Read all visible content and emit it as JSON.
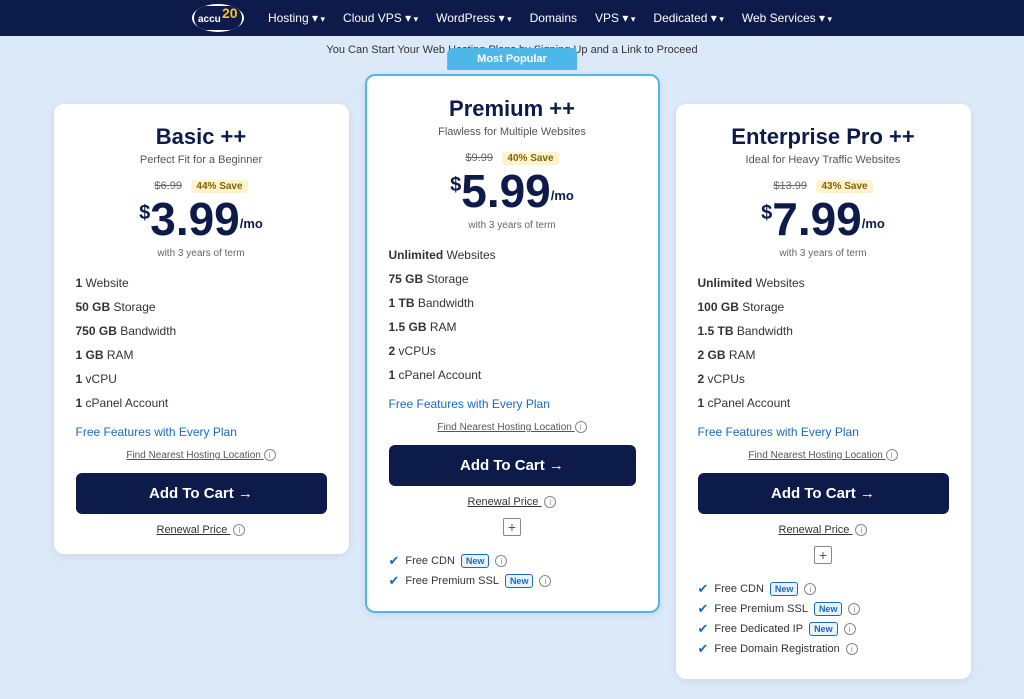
{
  "navbar": {
    "logo_text": "accu20",
    "items": [
      {
        "label": "Hosting",
        "has_arrow": true
      },
      {
        "label": "Cloud VPS",
        "has_arrow": true
      },
      {
        "label": "WordPress",
        "has_arrow": true
      },
      {
        "label": "Domains",
        "has_arrow": false
      },
      {
        "label": "VPS",
        "has_arrow": true
      },
      {
        "label": "Dedicated",
        "has_arrow": true
      },
      {
        "label": "Web Services",
        "has_arrow": true
      }
    ]
  },
  "subtitle": "You Can Start Your Web Hosting Plans by Signing Up and a Link to Proceed",
  "cards": [
    {
      "id": "basic",
      "title": "Basic ++",
      "subtitle": "Perfect Fit for a Beginner",
      "original_price": "$6.99",
      "save_badge": "44% Save",
      "current_price": "3.99",
      "price_suffix": "/mo",
      "price_term": "with 3 years of term",
      "features": [
        {
          "bold": "1",
          "text": " Website"
        },
        {
          "bold": "50 GB",
          "text": " Storage"
        },
        {
          "bold": "750 GB",
          "text": " Bandwidth"
        },
        {
          "bold": "1 GB",
          "text": " RAM"
        },
        {
          "bold": "1",
          "text": " vCPU"
        },
        {
          "bold": "1",
          "text": " cPanel Account"
        }
      ],
      "free_features_link": "Free Features with Every Plan",
      "hosting_location": "Find Nearest Hosting Location",
      "add_to_cart": "Add To Cart →",
      "renewal_price": "Renewal Price",
      "featured": false,
      "free_features": []
    },
    {
      "id": "premium",
      "title": "Premium ++",
      "subtitle": "Flawless for Multiple Websites",
      "original_price": "$9.99",
      "save_badge": "40% Save",
      "current_price": "5.99",
      "price_suffix": "/mo",
      "price_term": "with 3 years of term",
      "features": [
        {
          "bold": "Unlimited",
          "text": " Websites"
        },
        {
          "bold": "75 GB",
          "text": " Storage"
        },
        {
          "bold": "1 TB",
          "text": " Bandwidth"
        },
        {
          "bold": "1.5 GB",
          "text": " RAM"
        },
        {
          "bold": "2",
          "text": " vCPUs"
        },
        {
          "bold": "1",
          "text": " cPanel Account"
        }
      ],
      "free_features_link": "Free Features with Every Plan",
      "hosting_location": "Find Nearest Hosting Location",
      "add_to_cart": "Add To Cart →",
      "renewal_price": "Renewal Price",
      "featured": true,
      "most_popular": "Most Popular",
      "free_features": [
        {
          "text": "Free CDN",
          "badge": "New"
        },
        {
          "text": "Free Premium SSL",
          "badge": "New"
        }
      ]
    },
    {
      "id": "enterprise",
      "title": "Enterprise Pro ++",
      "subtitle": "Ideal for Heavy Traffic Websites",
      "original_price": "$13.99",
      "save_badge": "43% Save",
      "current_price": "7.99",
      "price_suffix": "/mo",
      "price_term": "with 3 years of term",
      "features": [
        {
          "bold": "Unlimited",
          "text": " Websites"
        },
        {
          "bold": "100 GB",
          "text": " Storage"
        },
        {
          "bold": "1.5 TB",
          "text": " Bandwidth"
        },
        {
          "bold": "2 GB",
          "text": " RAM"
        },
        {
          "bold": "2",
          "text": " vCPUs"
        },
        {
          "bold": "1",
          "text": " cPanel Account"
        }
      ],
      "free_features_link": "Free Features with Every Plan",
      "hosting_location": "Find Nearest Hosting Location",
      "add_to_cart": "Add To Cart →",
      "renewal_price": "Renewal Price",
      "featured": false,
      "free_features": [
        {
          "text": "Free CDN",
          "badge": "New"
        },
        {
          "text": "Free Premium SSL",
          "badge": "New"
        },
        {
          "text": "Free Dedicated IP",
          "badge": "New"
        },
        {
          "text": "Free Domain Registration",
          "badge": null
        }
      ]
    }
  ]
}
